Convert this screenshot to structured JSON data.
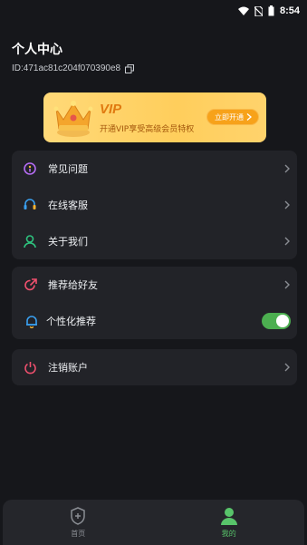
{
  "status_bar": {
    "time": "8:54"
  },
  "header": {
    "title": "个人中心",
    "user_id": "ID:471ac81c204f070390e8"
  },
  "vip": {
    "title": "VIP",
    "subtitle": "开通VIP享受高级会员特权",
    "button_label": "立即开通"
  },
  "menu_group_1": [
    {
      "label": "常见问题",
      "icon": "help-icon"
    },
    {
      "label": "在线客服",
      "icon": "headset-icon"
    },
    {
      "label": "关于我们",
      "icon": "person-icon"
    }
  ],
  "menu_group_2": [
    {
      "label": "推荐给好友",
      "icon": "share-icon"
    },
    {
      "label": "个性化推荐",
      "icon": "bell-icon",
      "toggle_on": true
    }
  ],
  "menu_group_3": [
    {
      "label": "注销账户",
      "icon": "power-icon"
    }
  ],
  "tabs": [
    {
      "label": "首页",
      "icon": "shield-plus-icon",
      "active": false
    },
    {
      "label": "我的",
      "icon": "user-icon",
      "active": true
    }
  ],
  "colors": {
    "background": "#16171b",
    "card": "#222328",
    "accent_green": "#58c46a",
    "vip_gold": "#ffd36c"
  }
}
